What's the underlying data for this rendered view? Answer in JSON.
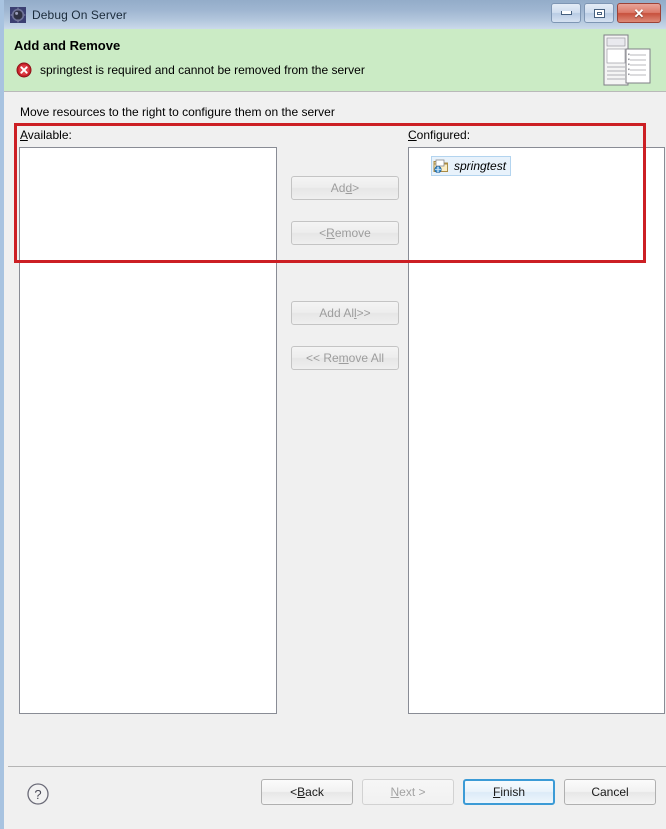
{
  "window": {
    "title": "Debug On Server",
    "app_icon": "gear-icon",
    "controls": {
      "minimize": "minimize-icon",
      "maximize": "maximize-icon",
      "close": "✕"
    }
  },
  "banner": {
    "title": "Add and Remove",
    "message": "springtest is required and cannot be removed from the server",
    "status_icon": "error-icon",
    "artwork": "server-document-icon",
    "background_color": "#cbebc5",
    "error_color": "#cc2222"
  },
  "main": {
    "instruction": "Move resources to the right to configure them on the server",
    "available": {
      "label_prefix": "A",
      "label_rest": "vailable:",
      "items": []
    },
    "configured": {
      "label_prefix": "C",
      "label_rest": "onfigured:",
      "items": [
        {
          "label": "springtest",
          "icon": "module-project-icon",
          "selected": true
        }
      ]
    },
    "transfer_buttons": [
      {
        "pre": "Ad",
        "mn": "d",
        "post": " >",
        "enabled": false
      },
      {
        "pre": "< ",
        "mn": "R",
        "post": "emove",
        "enabled": false
      },
      {
        "pre": "Add Al",
        "mn": "l",
        "post": " >>",
        "enabled": false
      },
      {
        "pre": "<< Re",
        "mn": "m",
        "post": "ove All",
        "enabled": false
      }
    ]
  },
  "footer": {
    "help_icon": "help-question-icon",
    "buttons": [
      {
        "pre": "< ",
        "mn": "B",
        "post": "ack",
        "enabled": true,
        "default": false
      },
      {
        "pre": "",
        "mn": "N",
        "post": "ext >",
        "enabled": false,
        "default": false
      },
      {
        "pre": "",
        "mn": "F",
        "post": "inish",
        "enabled": true,
        "default": true
      },
      {
        "pre": "Cancel",
        "mn": "",
        "post": "",
        "enabled": true,
        "default": false
      }
    ]
  },
  "annotation": {
    "type": "highlight-rectangle",
    "color": "#cc1f24"
  }
}
